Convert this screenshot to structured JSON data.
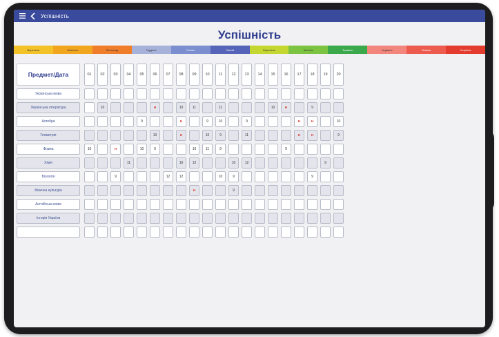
{
  "app": {
    "title": "Успішність"
  },
  "page": {
    "title": "Успішність"
  },
  "months": [
    {
      "label": "Вересень",
      "color": "#f2c228"
    },
    {
      "label": "Жовтень",
      "color": "#f2a51f"
    },
    {
      "label": "Листопад",
      "color": "#ef7d2a"
    },
    {
      "label": "Грудень",
      "color": "#a6b2da",
      "active": false
    },
    {
      "label": "Січень",
      "color": "#7a8ed0",
      "active": true
    },
    {
      "label": "Лютий",
      "color": "#5563b8",
      "active": true
    },
    {
      "label": "Березень",
      "color": "#c4d730"
    },
    {
      "label": "Квітень",
      "color": "#7cc341"
    },
    {
      "label": "Травень",
      "color": "#3aa84b",
      "active": true
    },
    {
      "label": "Червень",
      "color": "#f2867c"
    },
    {
      "label": "Липень",
      "color": "#ed5b4e",
      "active": true
    },
    {
      "label": "Серпень",
      "color": "#e33b2d",
      "active": true
    }
  ],
  "table": {
    "header_label": "Предмет/Дата",
    "dates": [
      "01",
      "02",
      "03",
      "04",
      "05",
      "06",
      "07",
      "08",
      "09",
      "10",
      "11",
      "12",
      "13",
      "14",
      "15",
      "16",
      "17",
      "18",
      "19",
      "20"
    ],
    "rows": [
      {
        "subject": "Українська мова",
        "white": true,
        "shade": "",
        "cells": [
          "",
          "",
          "",
          "",
          "",
          "",
          "",
          "",
          "",
          "",
          "",
          "",
          "",
          "",
          "",
          "",
          "",
          "",
          "",
          ""
        ]
      },
      {
        "subject": "Українська література",
        "white": false,
        "shade": "01111111111111111111",
        "cells": [
          "",
          "10",
          "",
          "",
          "",
          "н",
          "",
          "10",
          "11",
          "",
          "11",
          "",
          "",
          "",
          "10",
          "н",
          "",
          "9",
          "",
          ""
        ]
      },
      {
        "subject": "Алгебра",
        "white": true,
        "shade": "",
        "cells": [
          "",
          "",
          "",
          "",
          "9",
          "",
          "",
          "н",
          "",
          "9",
          "10",
          "",
          "9",
          "",
          "",
          "",
          "н",
          "н",
          "",
          "10"
        ]
      },
      {
        "subject": "Геометрія",
        "white": false,
        "shade": "11111111111111111111",
        "cells": [
          "",
          "",
          "",
          "",
          "",
          "10",
          "",
          "н",
          "",
          "10",
          "9",
          "",
          "11",
          "",
          "",
          "",
          "н",
          "н",
          "",
          "9"
        ]
      },
      {
        "subject": "Фізика",
        "white": true,
        "shade": "",
        "cells": [
          "10",
          "",
          "н",
          "",
          "10",
          "9",
          "",
          "",
          "10",
          "11",
          "9",
          "",
          "",
          "",
          "",
          "9",
          "",
          "",
          "",
          ""
        ]
      },
      {
        "subject": "Хімія",
        "white": false,
        "shade": "11111111111111111111",
        "cells": [
          "",
          "",
          "",
          "11",
          "",
          "",
          "",
          "10",
          "12",
          "",
          "",
          "10",
          "12",
          "",
          "",
          "",
          "",
          "",
          "9",
          ""
        ]
      },
      {
        "subject": "Біологія",
        "white": true,
        "shade": "",
        "cells": [
          "",
          "",
          "9",
          "",
          "",
          "",
          "12",
          "12",
          "",
          "",
          "10",
          "9",
          "",
          "",
          "",
          "",
          "",
          "9",
          "",
          ""
        ]
      },
      {
        "subject": "Фізична культура",
        "white": false,
        "shade": "11111111111111111111",
        "cells": [
          "",
          "",
          "",
          "",
          "",
          "",
          "",
          "",
          "н",
          "",
          "",
          "9",
          "",
          "",
          "",
          "",
          "",
          "",
          "",
          ""
        ]
      },
      {
        "subject": "Англійська мова",
        "white": true,
        "shade": "",
        "cells": [
          "",
          "",
          "",
          "",
          "",
          "",
          "",
          "",
          "",
          "",
          "",
          "",
          "",
          "",
          "",
          "",
          "",
          "",
          "",
          ""
        ]
      },
      {
        "subject": "Історія України",
        "white": false,
        "shade": "11111111111111111111",
        "cells": [
          "",
          "",
          "",
          "",
          "",
          "",
          "",
          "",
          "",
          "",
          "",
          "",
          "",
          "",
          "",
          "",
          "",
          "",
          "",
          ""
        ]
      },
      {
        "subject": "",
        "white": true,
        "shade": "",
        "cells": [
          "",
          "",
          "",
          "",
          "",
          "",
          "",
          "",
          "",
          "",
          "",
          "",
          "",
          "",
          "",
          "",
          "",
          "",
          "",
          ""
        ]
      }
    ]
  },
  "icons": {
    "menu": "menu-icon",
    "back": "back-arrow-icon"
  },
  "colors": {
    "appbar": "#3a4a9c",
    "title": "#2f3d8f",
    "mark_absent": "#d4281e"
  }
}
